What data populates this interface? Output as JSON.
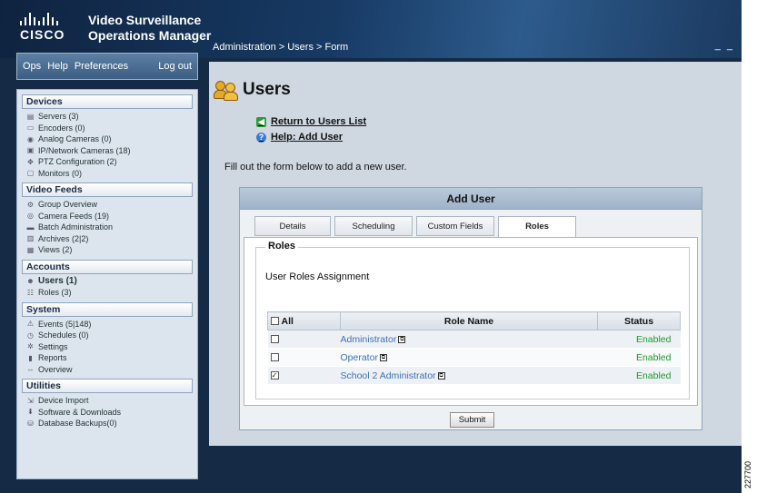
{
  "header": {
    "vendor": "CISCO",
    "product_line1": "Video Surveillance",
    "product_line2": "Operations Manager",
    "breadcrumb": "Administration > Users > Form",
    "window_controls": "_ _"
  },
  "nav": {
    "ops": "Ops",
    "help": "Help",
    "preferences": "Preferences",
    "logout": "Log out"
  },
  "sidebar": {
    "sections": [
      {
        "title": "Devices",
        "items": [
          {
            "label": "Servers (3)",
            "icon": "server-icon"
          },
          {
            "label": "Encoders (0)",
            "icon": "encoder-icon"
          },
          {
            "label": "Analog Cameras (0)",
            "icon": "analog-camera-icon"
          },
          {
            "label": "IP/Network Cameras (18)",
            "icon": "ip-camera-icon"
          },
          {
            "label": "PTZ Configuration (2)",
            "icon": "ptz-icon"
          },
          {
            "label": "Monitors (0)",
            "icon": "monitor-icon"
          }
        ]
      },
      {
        "title": "Video Feeds",
        "items": [
          {
            "label": "Group Overview",
            "icon": "group-icon"
          },
          {
            "label": "Camera Feeds (19)",
            "icon": "camera-feeds-icon"
          },
          {
            "label": "Batch Administration",
            "icon": "batch-icon"
          },
          {
            "label": "Archives (2|2)",
            "icon": "archive-icon"
          },
          {
            "label": "Views (2)",
            "icon": "views-icon"
          }
        ]
      },
      {
        "title": "Accounts",
        "items": [
          {
            "label": "Users (1)",
            "icon": "users-icon",
            "active": true
          },
          {
            "label": "Roles (3)",
            "icon": "roles-icon"
          }
        ]
      },
      {
        "title": "System",
        "items": [
          {
            "label": "Events (5|148)",
            "icon": "warning-icon"
          },
          {
            "label": "Schedules (0)",
            "icon": "clock-icon"
          },
          {
            "label": "Settings",
            "icon": "settings-icon"
          },
          {
            "label": "Reports",
            "icon": "reports-icon"
          },
          {
            "label": "Overview",
            "icon": "overview-icon"
          }
        ]
      },
      {
        "title": "Utilities",
        "items": [
          {
            "label": "Device Import",
            "icon": "import-icon"
          },
          {
            "label": "Software & Downloads",
            "icon": "download-icon"
          },
          {
            "label": "Database Backups(0)",
            "icon": "database-icon"
          }
        ]
      }
    ]
  },
  "main": {
    "title": "Users",
    "return_link": "Return to Users List",
    "help_link": "Help: Add User",
    "instructions": "Fill out the form below to add a new user.",
    "panel_title": "Add User",
    "tabs": [
      {
        "label": "Details",
        "selected": false
      },
      {
        "label": "Scheduling",
        "selected": false
      },
      {
        "label": "Custom Fields",
        "selected": false
      },
      {
        "label": "Roles",
        "selected": true
      }
    ],
    "roles_legend": "Roles",
    "assignment_title": "User Roles Assignment",
    "table": {
      "headers": [
        "All",
        "Role Name",
        "Status"
      ],
      "rows": [
        {
          "name": "Administrator",
          "status": "Enabled",
          "checked": false
        },
        {
          "name": "Operator",
          "status": "Enabled",
          "checked": false
        },
        {
          "name": "School 2 Administrator",
          "status": "Enabled",
          "checked": true
        }
      ]
    },
    "submit": "Submit"
  },
  "figure_id": "227700",
  "colors": {
    "link": "#3f6fb5",
    "enabled": "#1b9a2c",
    "header": "#173a64"
  }
}
